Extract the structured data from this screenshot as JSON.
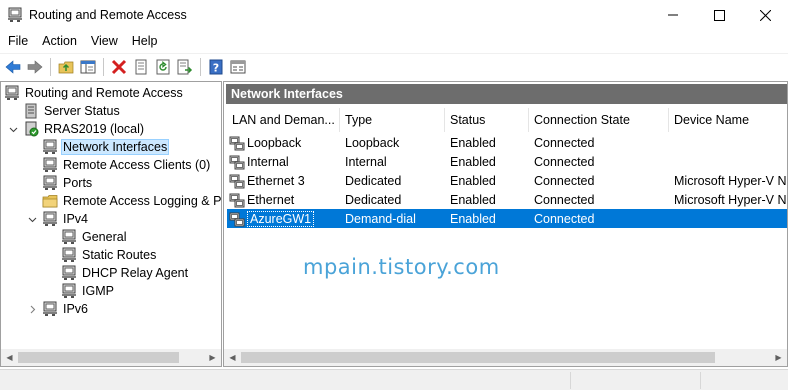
{
  "window": {
    "title": "Routing and Remote Access",
    "icons": {
      "app": "rras-server-icon",
      "minimize": "minimize-icon",
      "maximize": "maximize-icon",
      "close": "close-icon"
    }
  },
  "menu": [
    "File",
    "Action",
    "View",
    "Help"
  ],
  "toolbar": {
    "buttons": [
      "back-arrow-icon",
      "forward-arrow-icon",
      "up-folder-icon",
      "show-hide-tree-icon",
      "delete-icon",
      "properties-icon",
      "refresh-icon",
      "export-list-icon",
      "help-icon",
      "console-view-icon"
    ]
  },
  "tree": {
    "items": [
      {
        "label": "Routing and Remote Access",
        "icon": "rras-root-icon",
        "level": 0,
        "expanded": null
      },
      {
        "label": "Server Status",
        "icon": "server-status-icon",
        "level": 1,
        "expanded": null
      },
      {
        "label": "RRAS2019 (local)",
        "icon": "server-icon",
        "level": 1,
        "expanded": true
      },
      {
        "label": "Network Interfaces",
        "icon": "network-interfaces-icon",
        "level": 2,
        "selected": true
      },
      {
        "label": "Remote Access Clients (0)",
        "icon": "remote-clients-icon",
        "level": 2
      },
      {
        "label": "Ports",
        "icon": "ports-icon",
        "level": 2
      },
      {
        "label": "Remote Access Logging & Po",
        "icon": "logging-folder-icon",
        "level": 2
      },
      {
        "label": "IPv4",
        "icon": "ipv4-icon",
        "level": 2,
        "expanded": true
      },
      {
        "label": "General",
        "icon": "general-icon",
        "level": 3
      },
      {
        "label": "Static Routes",
        "icon": "static-routes-icon",
        "level": 3
      },
      {
        "label": "DHCP Relay Agent",
        "icon": "dhcp-relay-icon",
        "level": 3
      },
      {
        "label": "IGMP",
        "icon": "igmp-icon",
        "level": 3
      },
      {
        "label": "IPv6",
        "icon": "ipv6-icon",
        "level": 2,
        "expanded": false
      }
    ]
  },
  "main": {
    "header": "Network Interfaces",
    "columns": [
      "LAN and Deman...",
      "Type",
      "Status",
      "Connection State",
      "Device Name"
    ],
    "rows": [
      {
        "name": "Loopback",
        "type": "Loopback",
        "status": "Enabled",
        "state": "Connected",
        "device": ""
      },
      {
        "name": "Internal",
        "type": "Internal",
        "status": "Enabled",
        "state": "Connected",
        "device": ""
      },
      {
        "name": "Ethernet 3",
        "type": "Dedicated",
        "status": "Enabled",
        "state": "Connected",
        "device": "Microsoft Hyper-V Ne"
      },
      {
        "name": "Ethernet",
        "type": "Dedicated",
        "status": "Enabled",
        "state": "Connected",
        "device": "Microsoft Hyper-V Ne"
      },
      {
        "name": "AzureGW1",
        "type": "Demand-dial",
        "status": "Enabled",
        "state": "Connected",
        "device": "",
        "selected": true
      }
    ],
    "watermark": "mpain.tistory.com"
  },
  "colors": {
    "selection": "#0078d7",
    "tree_selection": "#cce8ff",
    "header_bar": "#6d6d6d",
    "watermark": "#4aa3d8"
  }
}
